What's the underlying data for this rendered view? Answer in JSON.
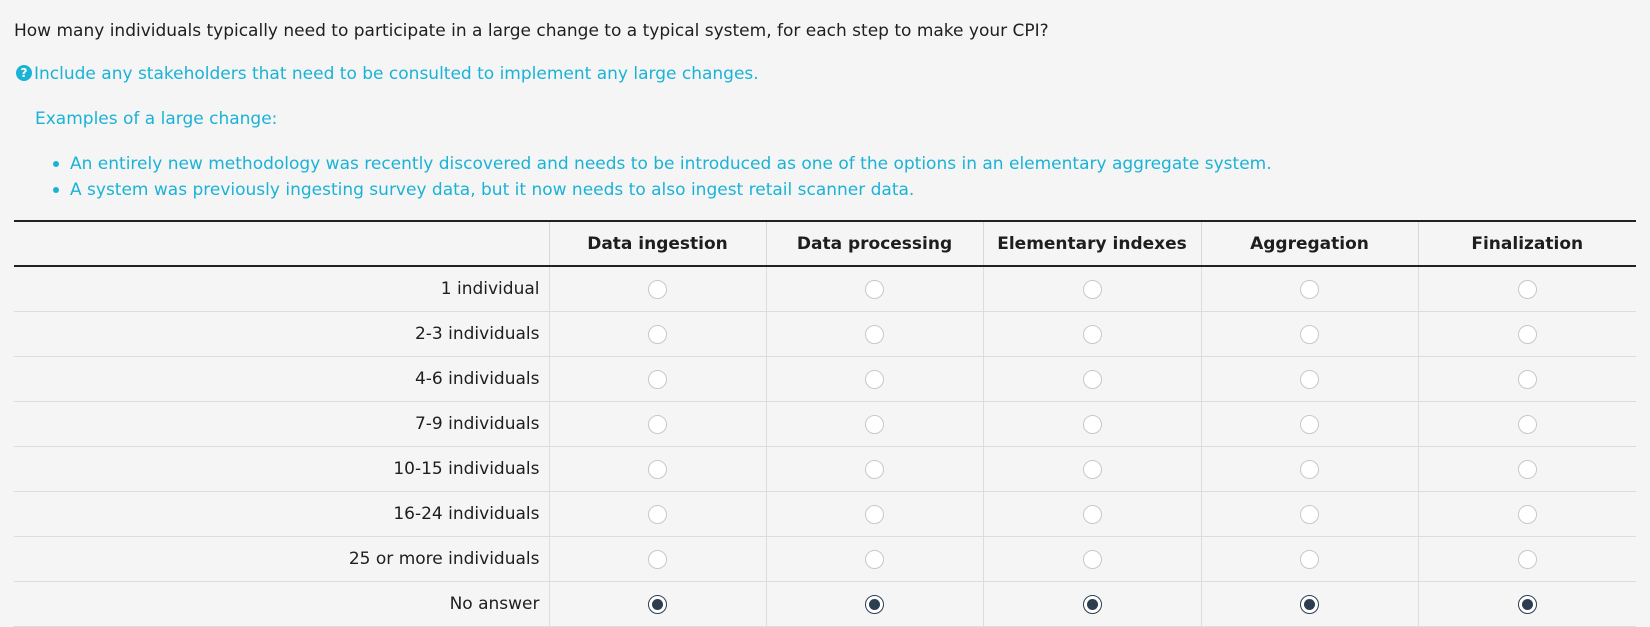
{
  "question": {
    "text": "How many individuals typically need to participate in a large change to a typical system, for each step to make your CPI?",
    "help": "Include any stakeholders that need to be consulted to implement any large changes.",
    "examples_title": "Examples of a large change:",
    "examples": [
      "An entirely new methodology was recently discovered and needs to be introduced as one of the options in an elementary aggregate system.",
      "A system was previously ingesting survey data, but it now needs to also ingest retail scanner data."
    ]
  },
  "matrix": {
    "columns": [
      "Data ingestion",
      "Data processing",
      "Elementary indexes",
      "Aggregation",
      "Finalization"
    ],
    "rows": [
      "1 individual",
      "2-3 individuals",
      "4-6 individuals",
      "7-9 individuals",
      "10-15 individuals",
      "16-24 individuals",
      "25 or more individuals",
      "No answer"
    ],
    "selected_row": "No answer"
  },
  "colors": {
    "help_accent": "#1ab3d6",
    "radio_selected": "#2c3e50"
  }
}
